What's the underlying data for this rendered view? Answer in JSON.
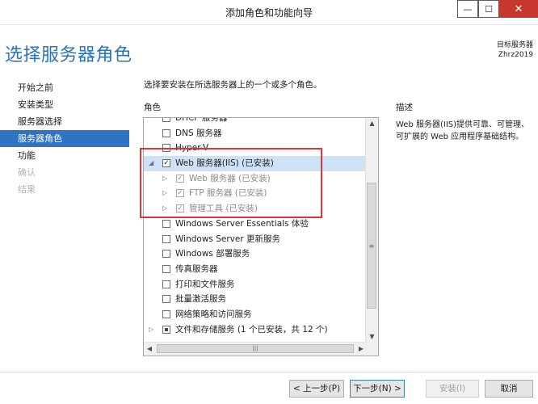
{
  "window": {
    "title": "添加角色和功能向导",
    "minimize_glyph": "—",
    "maximize_glyph": "☐",
    "close_glyph": "✕"
  },
  "page": {
    "heading": "选择服务器角色",
    "target_label": "目标服务器",
    "target_server": "Zhrz2019"
  },
  "nav": {
    "items": [
      {
        "label": "开始之前",
        "state": "normal"
      },
      {
        "label": "安装类型",
        "state": "normal"
      },
      {
        "label": "服务器选择",
        "state": "normal"
      },
      {
        "label": "服务器角色",
        "state": "active"
      },
      {
        "label": "功能",
        "state": "normal"
      },
      {
        "label": "确认",
        "state": "disabled"
      },
      {
        "label": "结果",
        "state": "disabled"
      }
    ]
  },
  "content": {
    "instruction": "选择要安装在所选服务器上的一个或多个角色。",
    "roles_header": "角色",
    "description_header": "描述",
    "description_text": "Web 服务器(IIS)提供可靠、可管理、可扩展的 Web 应用程序基础结构。"
  },
  "roles": [
    {
      "label": "DHCP 服务器",
      "checked": false,
      "expander": "",
      "level": 0
    },
    {
      "label": "DNS 服务器",
      "checked": false,
      "expander": "",
      "level": 0
    },
    {
      "label": "Hyper-V",
      "checked": false,
      "expander": "",
      "level": 0
    },
    {
      "label": "Web 服务器(IIS) (已安装)",
      "checked": true,
      "expander": "◢",
      "level": 0,
      "selected": true
    },
    {
      "label": "Web 服务器 (已安装)",
      "checked": true,
      "expander": "▷",
      "level": 1,
      "disabled": true
    },
    {
      "label": "FTP 服务器 (已安装)",
      "checked": true,
      "expander": "▷",
      "level": 1,
      "disabled": true
    },
    {
      "label": "管理工具 (已安装)",
      "checked": true,
      "expander": "▷",
      "level": 1,
      "disabled": true
    },
    {
      "label": "Windows Server Essentials 体验",
      "checked": false,
      "expander": "",
      "level": 0
    },
    {
      "label": "Windows Server 更新服务",
      "checked": false,
      "expander": "",
      "level": 0
    },
    {
      "label": "Windows 部署服务",
      "checked": false,
      "expander": "",
      "level": 0
    },
    {
      "label": "传真服务器",
      "checked": false,
      "expander": "",
      "level": 0
    },
    {
      "label": "打印和文件服务",
      "checked": false,
      "expander": "",
      "level": 0
    },
    {
      "label": "批量激活服务",
      "checked": false,
      "expander": "",
      "level": 0
    },
    {
      "label": "网络策略和访问服务",
      "checked": false,
      "expander": "",
      "level": 0
    },
    {
      "label": "文件和存储服务 (1 个已安装，共 12 个)",
      "checked": "partial",
      "expander": "▷",
      "level": 0
    }
  ],
  "scrollbars": {
    "up_glyph": "▲",
    "down_glyph": "▼",
    "thumb_glyph": "≡",
    "left_glyph": "◀",
    "right_glyph": "▶",
    "hthumb_glyph": "|||"
  },
  "buttons": {
    "prev": "< 上一步(P)",
    "next": "下一步(N) >",
    "install": "安装(I)",
    "cancel": "取消"
  }
}
